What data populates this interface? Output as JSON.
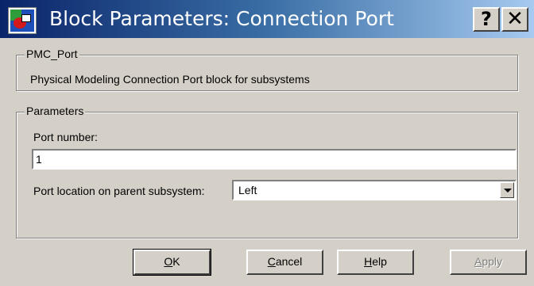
{
  "window": {
    "title": "Block Parameters: Connection Port",
    "help_glyph": "?",
    "close_glyph": "✕"
  },
  "description_group": {
    "label": "PMC_Port",
    "text": "Physical Modeling Connection Port block for subsystems"
  },
  "parameters_group": {
    "label": "Parameters",
    "port_number": {
      "label": "Port number:",
      "value": "1"
    },
    "port_location": {
      "label": "Port location on parent subsystem:",
      "selected": "Left"
    }
  },
  "buttons": {
    "ok": {
      "mnemonic": "O",
      "rest": "K"
    },
    "cancel": {
      "mnemonic": "C",
      "rest": "ancel"
    },
    "help": {
      "mnemonic": "H",
      "rest": "elp"
    },
    "apply": {
      "mnemonic": "A",
      "rest": "pply"
    }
  },
  "colors": {
    "title_gradient_start": "#0a246a",
    "title_gradient_end": "#a6caf0",
    "dialog_face": "#d4d0c8"
  }
}
